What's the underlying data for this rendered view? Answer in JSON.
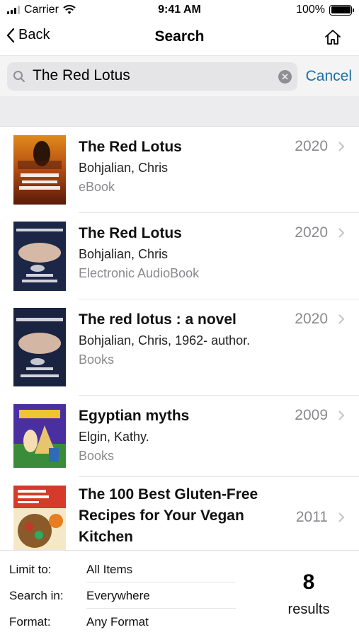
{
  "status_bar": {
    "carrier": "Carrier",
    "time": "9:41 AM",
    "battery": "100%",
    "icons": [
      "signal-icon",
      "wifi-icon",
      "battery-icon"
    ]
  },
  "nav": {
    "back_label": "Back",
    "title": "Search",
    "icons": [
      "chevron-left-icon",
      "home-icon"
    ]
  },
  "search": {
    "value": "The Red Lotus",
    "cancel_label": "Cancel",
    "icons": [
      "search-icon",
      "clear-icon"
    ],
    "accent_color": "#1a6fa8"
  },
  "results": [
    {
      "title": "The Red Lotus",
      "author": "Bohjalian, Chris",
      "format": "eBook",
      "year": "2020",
      "cover_icon": "book-cover-thumbnail"
    },
    {
      "title": "The Red Lotus",
      "author": "Bohjalian, Chris",
      "format": "Electronic AudioBook",
      "year": "2020",
      "cover_icon": "book-cover-thumbnail"
    },
    {
      "title": "The red lotus : a novel",
      "author": "Bohjalian, Chris, 1962- author.",
      "format": "Books",
      "year": "2020",
      "cover_icon": "book-cover-thumbnail"
    },
    {
      "title": "Egyptian myths",
      "author": "Elgin, Kathy.",
      "format": "Books",
      "year": "2009",
      "cover_icon": "book-cover-thumbnail"
    },
    {
      "title": "The 100 Best Gluten-Free Recipes for Your Vegan Kitchen",
      "author": "",
      "format": "",
      "year": "2011",
      "cover_icon": "book-cover-thumbnail"
    }
  ],
  "footer": {
    "limit_label": "Limit to:",
    "limit_value": "All Items",
    "search_in_label": "Search in:",
    "search_in_value": "Everywhere",
    "format_label": "Format:",
    "format_value": "Any Format",
    "count": "8",
    "count_label": "results"
  }
}
